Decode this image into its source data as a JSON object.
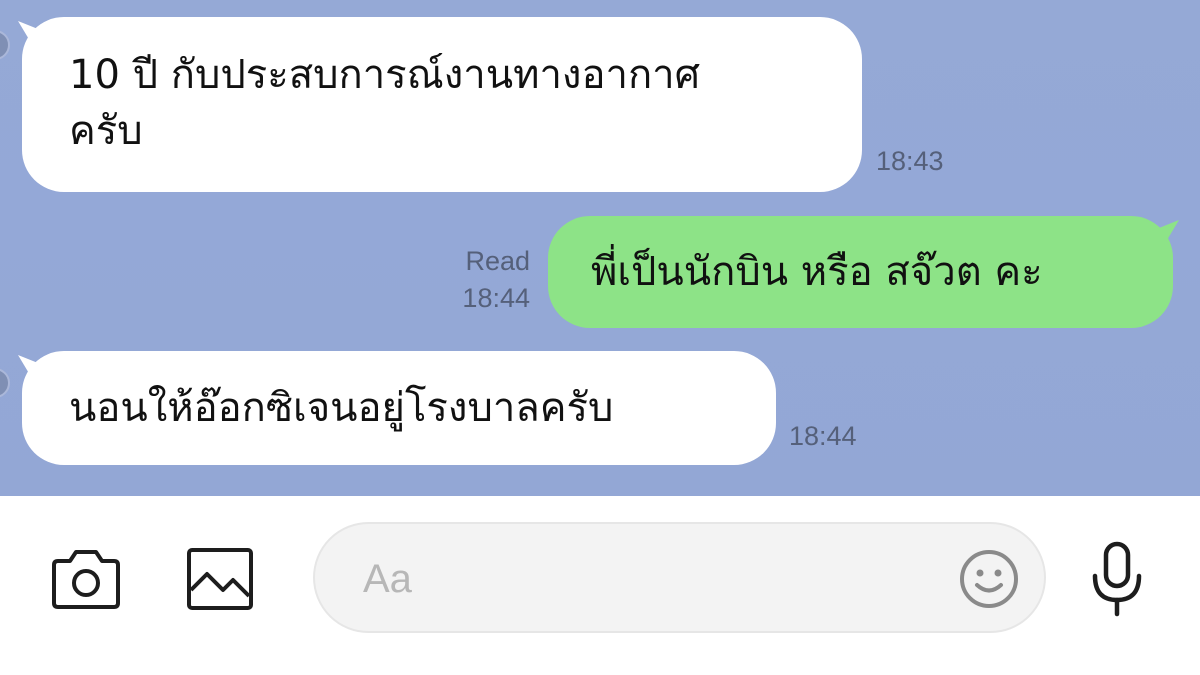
{
  "messages": [
    {
      "direction": "incoming",
      "lines": [
        "10 ปี กับประสบการณ์งานทางอากาศ",
        "ครับ"
      ],
      "time": "18:43"
    },
    {
      "direction": "outgoing",
      "text": "พี่เป็นนักบิน หรือ สจ๊วต คะ",
      "read_label": "Read",
      "time": "18:44"
    },
    {
      "direction": "incoming",
      "text": "นอนให้อ๊อกซิเจนอยู่โรงบาลครับ",
      "time": "18:44"
    }
  ],
  "input": {
    "placeholder": "Aa"
  },
  "toolbar": {
    "icons": [
      "camera-icon",
      "image-icon",
      "emoji-icon",
      "microphone-icon"
    ]
  },
  "colors": {
    "chat_background": "#94a8d7",
    "incoming_bubble": "#ffffff",
    "outgoing_bubble": "#8de387",
    "meta_text": "#55607a"
  }
}
